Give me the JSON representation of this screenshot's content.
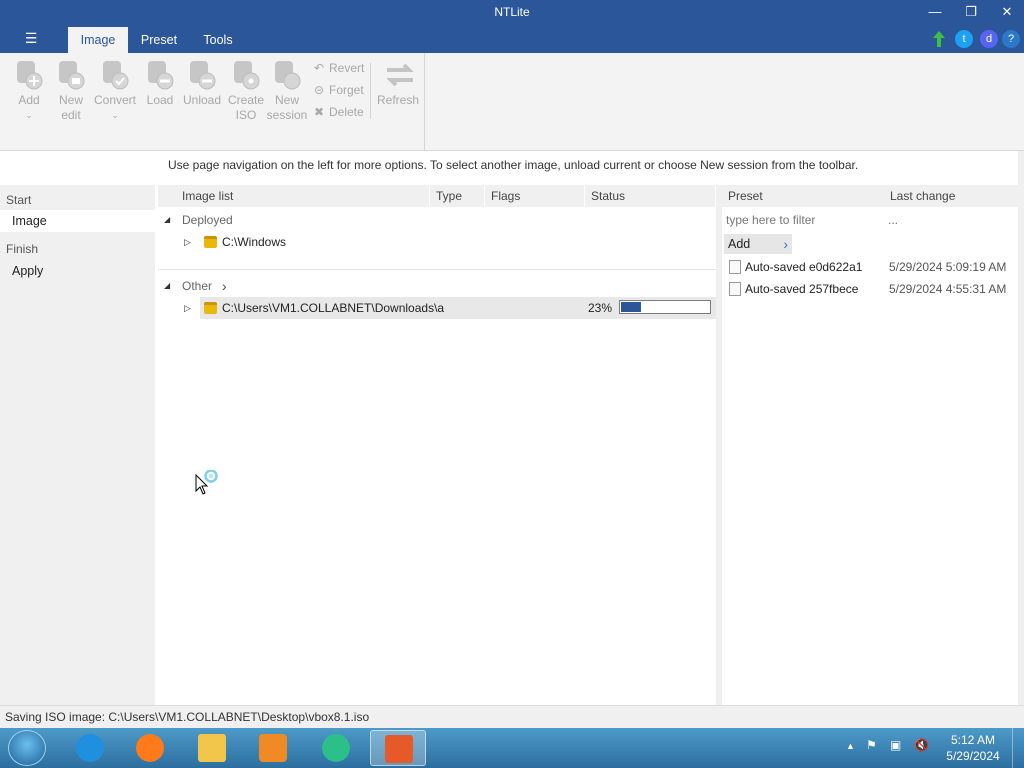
{
  "window": {
    "title": "NTLite"
  },
  "menu": {
    "hamburger": "☰"
  },
  "tabs": [
    {
      "label": "Image",
      "active": true
    },
    {
      "label": "Preset",
      "active": false
    },
    {
      "label": "Tools",
      "active": false
    }
  ],
  "ribbon": {
    "buttons": [
      {
        "label": "Add",
        "icon": "add-disk-icon"
      },
      {
        "label": "New\nedit",
        "icon": "new-edit-icon"
      },
      {
        "label": "Convert",
        "icon": "convert-icon"
      },
      {
        "label": "Load",
        "icon": "load-icon"
      },
      {
        "label": "Unload",
        "icon": "unload-icon"
      },
      {
        "label": "Create\nISO",
        "icon": "create-iso-icon"
      },
      {
        "label": "New\nsession",
        "icon": "new-session-icon"
      }
    ],
    "small_buttons": [
      {
        "label": "Revert",
        "icon": "revert-icon"
      },
      {
        "label": "Forget",
        "icon": "forget-icon"
      },
      {
        "label": "Delete",
        "icon": "delete-icon"
      }
    ],
    "refresh": {
      "label": "Refresh",
      "icon": "refresh-icon"
    }
  },
  "hint": "Use page navigation on the left for more options. To select another image, unload current or choose New session from the toolbar.",
  "nav": {
    "start_group": "Start",
    "image_item": "Image",
    "finish_group": "Finish",
    "apply_item": "Apply"
  },
  "image_list": {
    "columns": [
      "Image list",
      "Type",
      "Flags",
      "Status"
    ],
    "groups": [
      {
        "label": "Deployed",
        "rows": [
          {
            "path": "C:\\Windows"
          }
        ]
      },
      {
        "label": "Other",
        "rows": [
          {
            "path": "C:\\Users\\VM1.COLLABNET\\Downloads\\a",
            "status": "23%",
            "progress": 0.23
          }
        ]
      }
    ]
  },
  "presets": {
    "columns": [
      "Preset",
      "Last change"
    ],
    "filter_placeholder": "type here to filter",
    "filter_more": "...",
    "add_label": "Add",
    "items": [
      {
        "name": "Auto-saved e0d622a1",
        "date": "5/29/2024 5:09:19 AM"
      },
      {
        "name": "Auto-saved 257fbece",
        "date": "5/29/2024 4:55:31 AM"
      }
    ]
  },
  "status_bar": "Saving ISO image: C:\\Users\\VM1.COLLABNET\\Desktop\\vbox8.1.iso",
  "taskbar": {
    "time": "5:12 AM",
    "date": "5/29/2024",
    "apps": [
      {
        "name": "internet-explorer-icon",
        "color": "#1f8fe0"
      },
      {
        "name": "firefox-icon",
        "color": "#ff7a1a"
      },
      {
        "name": "file-explorer-icon",
        "color": "#f2c64a"
      },
      {
        "name": "media-player-icon",
        "color": "#f08a24"
      },
      {
        "name": "app-bird-icon",
        "color": "#2bbf8a"
      },
      {
        "name": "ntlite-icon",
        "color": "#e65a2a"
      }
    ]
  },
  "colors": {
    "accent": "#2b569a",
    "progress": "#2b569a"
  }
}
